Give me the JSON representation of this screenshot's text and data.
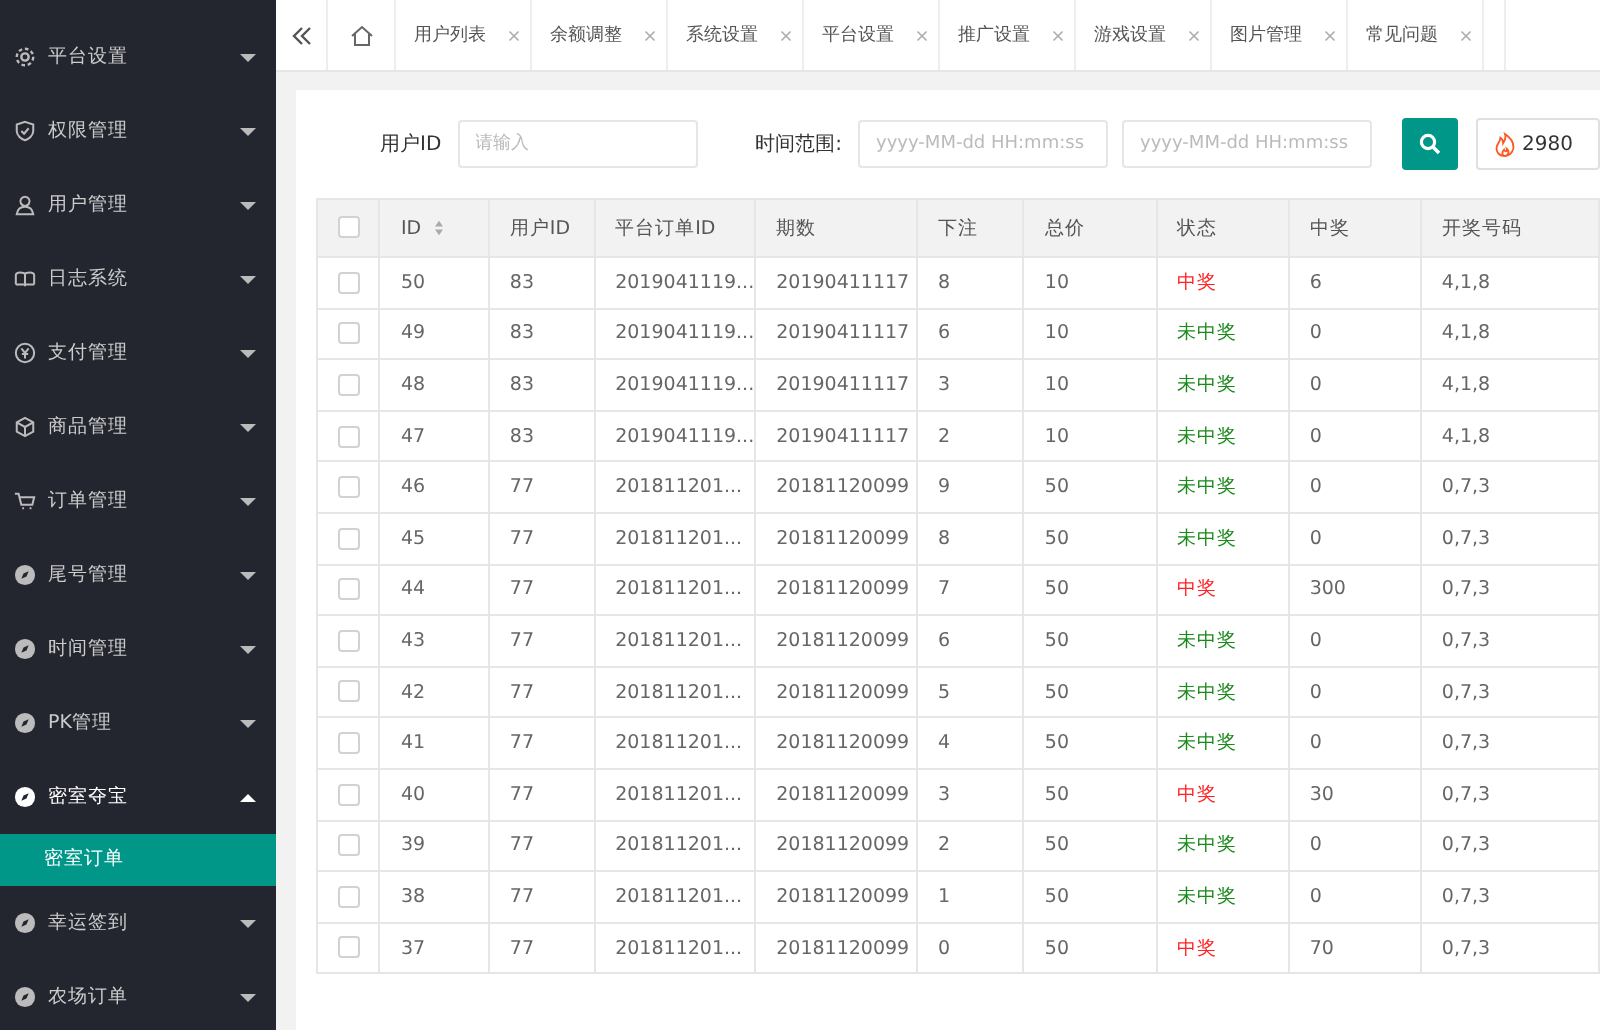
{
  "sidebar": {
    "items": [
      {
        "label": "平台设置",
        "expanded": false
      },
      {
        "label": "权限管理",
        "expanded": false
      },
      {
        "label": "用户管理",
        "expanded": false
      },
      {
        "label": "日志系统",
        "expanded": false
      },
      {
        "label": "支付管理",
        "expanded": false
      },
      {
        "label": "商品管理",
        "expanded": false
      },
      {
        "label": "订单管理",
        "expanded": false
      },
      {
        "label": "尾号管理",
        "expanded": false
      },
      {
        "label": "时间管理",
        "expanded": false
      },
      {
        "label": "PK管理",
        "expanded": false
      },
      {
        "label": "密室夺宝",
        "expanded": true,
        "children": [
          {
            "label": "密室订单",
            "selected": true
          }
        ]
      },
      {
        "label": "幸运签到",
        "expanded": false
      },
      {
        "label": "农场订单",
        "expanded": false
      }
    ]
  },
  "tabs": [
    {
      "label": "用户列表",
      "selected": false
    },
    {
      "label": "余额调整",
      "selected": false
    },
    {
      "label": "系统设置",
      "selected": false
    },
    {
      "label": "平台设置",
      "selected": false
    },
    {
      "label": "推广设置",
      "selected": false
    },
    {
      "label": "游戏设置",
      "selected": false
    },
    {
      "label": "图片管理",
      "selected": false
    },
    {
      "label": "常见问题",
      "selected": false
    }
  ],
  "filters": {
    "user_id_label": "用户ID",
    "user_id_placeholder": "请输入",
    "time_label": "时间范围:",
    "start_placeholder": "yyyy-MM-dd HH:mm:ss",
    "end_placeholder": "yyyy-MM-dd HH:mm:ss",
    "hot_count": "2980"
  },
  "table": {
    "header_checked": false,
    "columns": [
      "ID",
      "用户ID",
      "平台订单ID",
      "期数",
      "下注",
      "总价",
      "状态",
      "中奖",
      "开奖号码"
    ],
    "rows": [
      {
        "checked": false,
        "cells": [
          "50",
          "83",
          "2019041119...",
          "20190411117",
          "8",
          "10",
          "中奖",
          "6",
          "4,1,8"
        ],
        "kind": "win"
      },
      {
        "checked": false,
        "cells": [
          "49",
          "83",
          "2019041119...",
          "20190411117",
          "6",
          "10",
          "未中奖",
          "0",
          "4,1,8"
        ],
        "kind": "lose"
      },
      {
        "checked": false,
        "cells": [
          "48",
          "83",
          "2019041119...",
          "20190411117",
          "3",
          "10",
          "未中奖",
          "0",
          "4,1,8"
        ],
        "kind": "lose"
      },
      {
        "checked": false,
        "cells": [
          "47",
          "83",
          "2019041119...",
          "20190411117",
          "2",
          "10",
          "未中奖",
          "0",
          "4,1,8"
        ],
        "kind": "lose"
      },
      {
        "checked": false,
        "cells": [
          "46",
          "77",
          "201811201...",
          "20181120099",
          "9",
          "50",
          "未中奖",
          "0",
          "0,7,3"
        ],
        "kind": "lose"
      },
      {
        "checked": false,
        "cells": [
          "45",
          "77",
          "201811201...",
          "20181120099",
          "8",
          "50",
          "未中奖",
          "0",
          "0,7,3"
        ],
        "kind": "lose"
      },
      {
        "checked": false,
        "cells": [
          "44",
          "77",
          "201811201...",
          "20181120099",
          "7",
          "50",
          "中奖",
          "300",
          "0,7,3"
        ],
        "kind": "win"
      },
      {
        "checked": false,
        "cells": [
          "43",
          "77",
          "201811201...",
          "20181120099",
          "6",
          "50",
          "未中奖",
          "0",
          "0,7,3"
        ],
        "kind": "lose"
      },
      {
        "checked": false,
        "cells": [
          "42",
          "77",
          "201811201...",
          "20181120099",
          "5",
          "50",
          "未中奖",
          "0",
          "0,7,3"
        ],
        "kind": "lose"
      },
      {
        "checked": false,
        "cells": [
          "41",
          "77",
          "201811201...",
          "20181120099",
          "4",
          "50",
          "未中奖",
          "0",
          "0,7,3"
        ],
        "kind": "lose"
      },
      {
        "checked": false,
        "cells": [
          "40",
          "77",
          "201811201...",
          "20181120099",
          "3",
          "50",
          "中奖",
          "30",
          "0,7,3"
        ],
        "kind": "win"
      },
      {
        "checked": false,
        "cells": [
          "39",
          "77",
          "201811201...",
          "20181120099",
          "2",
          "50",
          "未中奖",
          "0",
          "0,7,3"
        ],
        "kind": "lose"
      },
      {
        "checked": false,
        "cells": [
          "38",
          "77",
          "201811201...",
          "20181120099",
          "1",
          "50",
          "未中奖",
          "0",
          "0,7,3"
        ],
        "kind": "lose"
      },
      {
        "checked": false,
        "cells": [
          "37",
          "77",
          "201811201...",
          "20181120099",
          "0",
          "50",
          "中奖",
          "70",
          "0,7,3"
        ],
        "kind": "win"
      }
    ]
  }
}
